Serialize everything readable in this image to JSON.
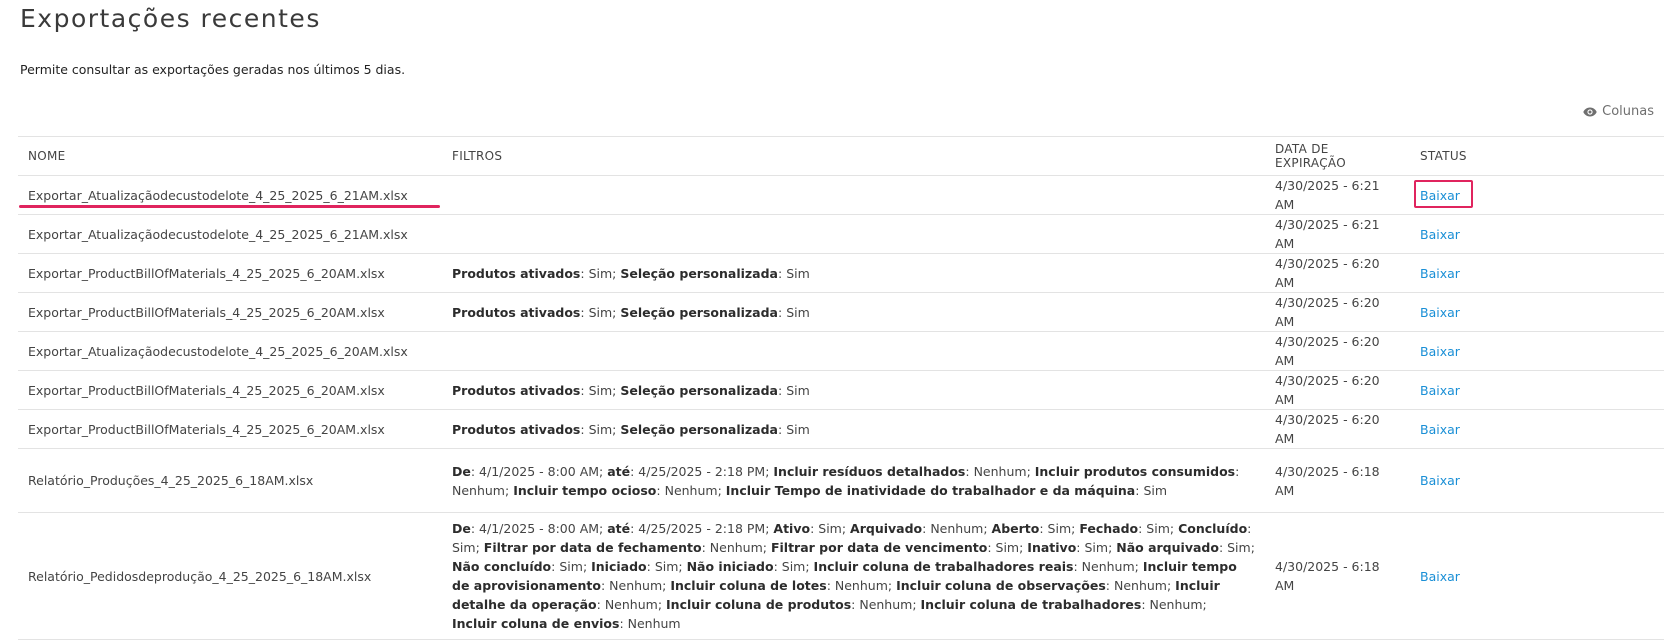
{
  "header": {
    "title": "Exportações recentes",
    "description": "Permite consultar as exportações geradas nos últimos 5 dias."
  },
  "toolbar": {
    "columns_label": "Colunas",
    "columns_icon": "eye-icon"
  },
  "table": {
    "headers": {
      "name": "NOME",
      "filters": "FILTROS",
      "expiration": "DATA DE EXPIRAÇÃO",
      "status": "STATUS"
    },
    "rows": [
      {
        "name": "Exportar_Atualizaçãodecustodelote_4_25_2025_6_21AM.xlsx",
        "filters": [],
        "expiration": "4/30/2025 - 6:21 AM",
        "status": "Baixar"
      },
      {
        "name": "Exportar_Atualizaçãodecustodelote_4_25_2025_6_21AM.xlsx",
        "filters": [],
        "expiration": "4/30/2025 - 6:21 AM",
        "status": "Baixar"
      },
      {
        "name": "Exportar_ProductBillOfMaterials_4_25_2025_6_20AM.xlsx",
        "filters": [
          {
            "k": "Produtos ativados",
            "v": "Sim"
          },
          {
            "k": "Seleção personalizada",
            "v": "Sim"
          }
        ],
        "expiration": "4/30/2025 - 6:20 AM",
        "status": "Baixar"
      },
      {
        "name": "Exportar_ProductBillOfMaterials_4_25_2025_6_20AM.xlsx",
        "filters": [
          {
            "k": "Produtos ativados",
            "v": "Sim"
          },
          {
            "k": "Seleção personalizada",
            "v": "Sim"
          }
        ],
        "expiration": "4/30/2025 - 6:20 AM",
        "status": "Baixar"
      },
      {
        "name": "Exportar_Atualizaçãodecustodelote_4_25_2025_6_20AM.xlsx",
        "filters": [],
        "expiration": "4/30/2025 - 6:20 AM",
        "status": "Baixar"
      },
      {
        "name": "Exportar_ProductBillOfMaterials_4_25_2025_6_20AM.xlsx",
        "filters": [
          {
            "k": "Produtos ativados",
            "v": "Sim"
          },
          {
            "k": "Seleção personalizada",
            "v": "Sim"
          }
        ],
        "expiration": "4/30/2025 - 6:20 AM",
        "status": "Baixar"
      },
      {
        "name": "Exportar_ProductBillOfMaterials_4_25_2025_6_20AM.xlsx",
        "filters": [
          {
            "k": "Produtos ativados",
            "v": "Sim"
          },
          {
            "k": "Seleção personalizada",
            "v": "Sim"
          }
        ],
        "expiration": "4/30/2025 - 6:20 AM",
        "status": "Baixar"
      },
      {
        "name": "Relatório_Produções_4_25_2025_6_18AM.xlsx",
        "filters": [
          {
            "k": "De",
            "v": "4/1/2025 - 8:00 AM"
          },
          {
            "k": "até",
            "v": "4/25/2025 - 2:18 PM"
          },
          {
            "k": "Incluir resíduos detalhados",
            "v": "Nenhum"
          },
          {
            "k": "Incluir produtos consumidos",
            "v": "Nenhum"
          },
          {
            "k": "Incluir tempo ocioso",
            "v": "Nenhum"
          },
          {
            "k": "Incluir Tempo de inatividade do trabalhador e da máquina",
            "v": "Sim"
          }
        ],
        "expiration": "4/30/2025 - 6:18 AM",
        "status": "Baixar"
      },
      {
        "name": "Relatório_Pedidosdeprodução_4_25_2025_6_18AM.xlsx",
        "filters": [
          {
            "k": "De",
            "v": "4/1/2025 - 8:00 AM"
          },
          {
            "k": "até",
            "v": "4/25/2025 - 2:18 PM"
          },
          {
            "k": "Ativo",
            "v": "Sim"
          },
          {
            "k": "Arquivado",
            "v": "Nenhum"
          },
          {
            "k": "Aberto",
            "v": "Sim"
          },
          {
            "k": "Fechado",
            "v": "Sim"
          },
          {
            "k": "Concluído",
            "v": "Sim"
          },
          {
            "k": "Filtrar por data de fechamento",
            "v": "Nenhum"
          },
          {
            "k": "Filtrar por data de vencimento",
            "v": "Sim"
          },
          {
            "k": "Inativo",
            "v": "Sim"
          },
          {
            "k": "Não arquivado",
            "v": "Sim"
          },
          {
            "k": "Não concluído",
            "v": "Sim"
          },
          {
            "k": "Iniciado",
            "v": "Sim"
          },
          {
            "k": "Não iniciado",
            "v": "Sim"
          },
          {
            "k": "Incluir coluna de trabalhadores reais",
            "v": "Nenhum"
          },
          {
            "k": "Incluir tempo de aprovisionamento",
            "v": "Nenhum"
          },
          {
            "k": "Incluir coluna de lotes",
            "v": "Nenhum"
          },
          {
            "k": "Incluir coluna de observações",
            "v": "Nenhum"
          },
          {
            "k": "Incluir detalhe da operação",
            "v": "Nenhum"
          },
          {
            "k": "Incluir coluna de produtos",
            "v": "Nenhum"
          },
          {
            "k": "Incluir coluna de trabalhadores",
            "v": "Nenhum"
          },
          {
            "k": "Incluir coluna de envios",
            "v": "Nenhum"
          }
        ],
        "expiration": "4/30/2025 - 6:18 AM",
        "status": "Baixar"
      }
    ]
  },
  "colors": {
    "link": "#1a8fd6",
    "highlight": "#e0245e",
    "border": "#e3e3e3"
  }
}
